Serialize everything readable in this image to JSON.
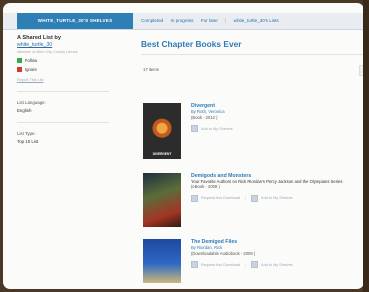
{
  "nav": {
    "shelves_tab": "WHITE_TURTLE_30'S SHELVES",
    "links": [
      "Completed",
      "In progress",
      "For later",
      "white_turtle_30's Lists"
    ]
  },
  "sidebar": {
    "title": "A Shared List by",
    "owner": "white_turtle_30",
    "member_note": "Member of Allen City County Library",
    "follow_label": "Follow",
    "ignore_label": "Ignore",
    "report_label": "Report This List",
    "language_label": "List Language:",
    "language_value": "English",
    "type_label": "List Type:",
    "type_value": "Top 10 List",
    "follow_color": "#39a845",
    "ignore_color": "#d33b2b"
  },
  "main": {
    "title": "Best Chapter Books Ever",
    "items_count": "17 items",
    "pager": "«"
  },
  "books": [
    {
      "title": "Divergent",
      "subtitle": "",
      "author": "By Roth, Veronica",
      "format": "(Book - 2012 )",
      "cover_text": "DIVERGENT",
      "actions": [
        "Add to My Shelves"
      ]
    },
    {
      "title": "Demigods and Monsters",
      "subtitle": "Your Favorite Authors on Rick Riordan's Percy Jackson and the Olympians Series",
      "author": "",
      "format": "(eBook - 2008 )",
      "cover_text": "",
      "actions": [
        "Request this Download",
        "Add to My Shelves"
      ]
    },
    {
      "title": "The Demigod Files",
      "subtitle": "",
      "author": "By Riordan, Rick",
      "format": "(Downloadable Audiobook - 2009 )",
      "cover_text": "",
      "actions": [
        "Request this Download",
        "Add to My Shelves"
      ]
    }
  ]
}
